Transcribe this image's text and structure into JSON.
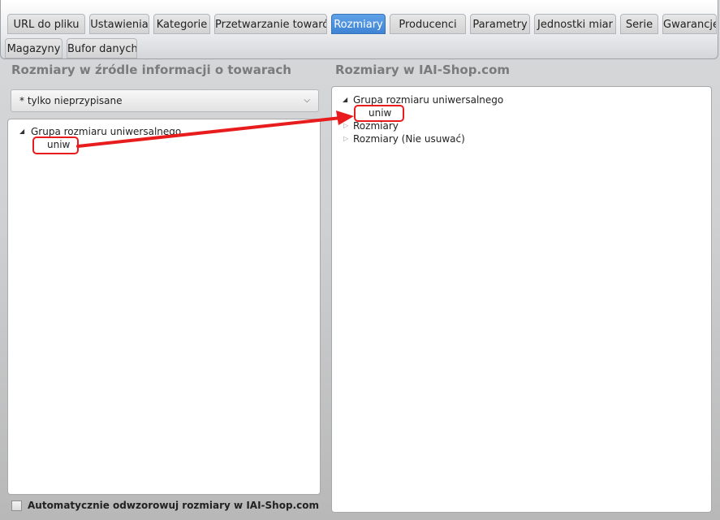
{
  "tabs": [
    {
      "label": "URL do pliku",
      "active": false
    },
    {
      "label": "Ustawienia",
      "active": false
    },
    {
      "label": "Kategorie",
      "active": false
    },
    {
      "label": "Przetwarzanie towarów",
      "active": false
    },
    {
      "label": "Rozmiary",
      "active": true
    },
    {
      "label": "Producenci",
      "active": false
    },
    {
      "label": "Parametry",
      "active": false
    },
    {
      "label": "Jednostki miar",
      "active": false
    },
    {
      "label": "Serie",
      "active": false
    },
    {
      "label": "Gwarancje",
      "active": false
    },
    {
      "label": "Magazyny",
      "active": false
    },
    {
      "label": "Bufor danych",
      "active": false
    }
  ],
  "left": {
    "heading": "Rozmiary w źródle informacji o towarach",
    "filter_value": "* tylko nieprzypisane",
    "tree": {
      "group_label": "Grupa rozmiaru uniwersalnego",
      "child_label": "uniw"
    }
  },
  "right": {
    "heading": "Rozmiary w IAI-Shop.com",
    "tree": {
      "group_label": "Grupa rozmiaru uniwersalnego",
      "child_label": "uniw",
      "other_items": [
        "Rozmiary",
        "Rozmiary (Nie usuwać)"
      ]
    }
  },
  "auto_map": {
    "label": "Automatycznie odwzorowuj rozmiary w IAI-Shop.com",
    "checked": false
  },
  "colors": {
    "active_tab": "#3f84d4",
    "highlight": "#e81c1c"
  },
  "icons": {
    "expanded": "triangle-expanded-icon",
    "collapsed": "triangle-collapsed-icon",
    "dropdown": "chevron-down-icon"
  }
}
